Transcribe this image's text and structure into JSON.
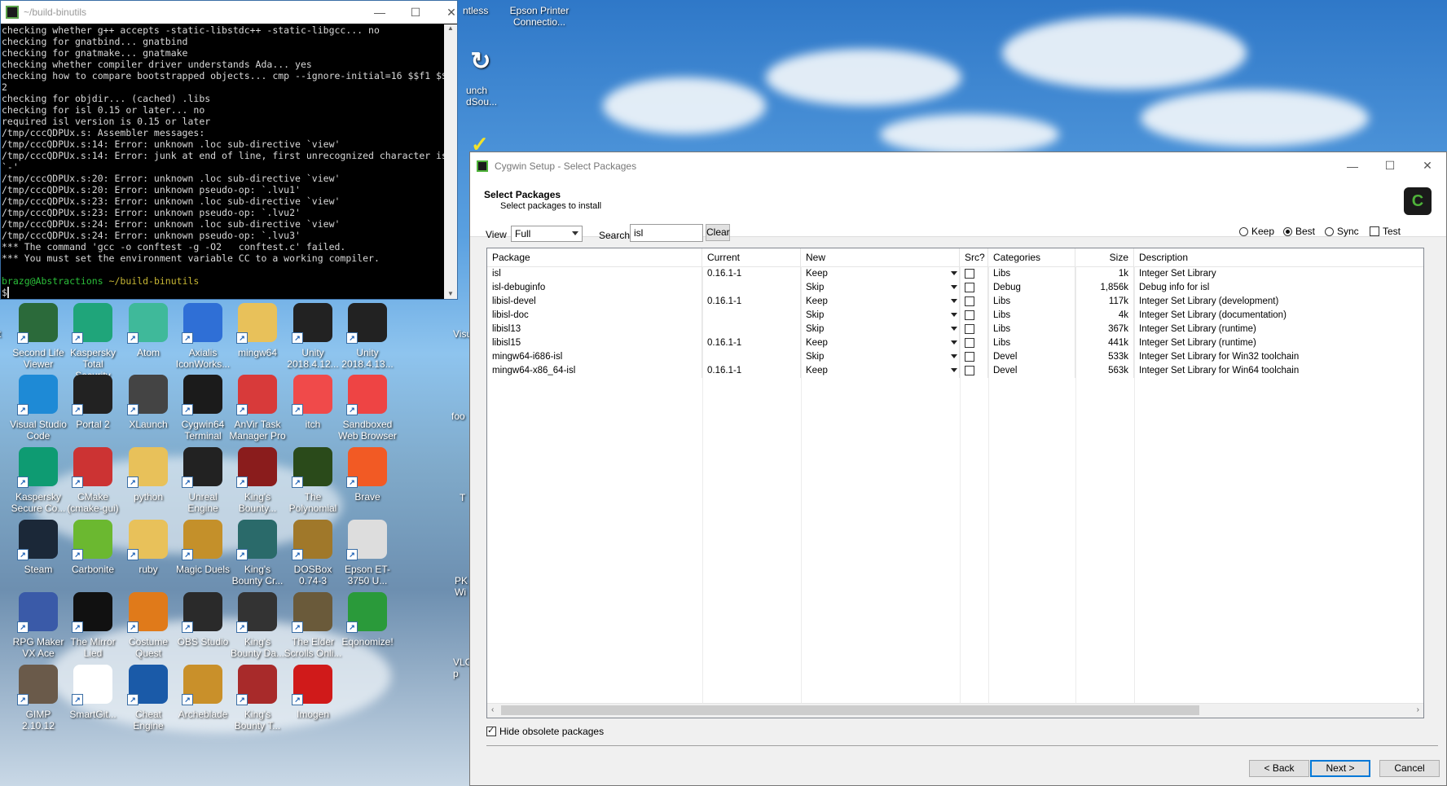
{
  "terminal": {
    "title": "~/build-binutils",
    "lines": [
      "checking whether g++ accepts -static-libstdc++ -static-libgcc... no",
      "checking for gnatbind... gnatbind",
      "checking for gnatmake... gnatmake",
      "checking whether compiler driver understands Ada... yes",
      "checking how to compare bootstrapped objects... cmp --ignore-initial=16 $$f1 $$f",
      "2",
      "checking for objdir... (cached) .libs",
      "checking for isl 0.15 or later... no",
      "required isl version is 0.15 or later",
      "/tmp/cccQDPUx.s: Assembler messages:",
      "/tmp/cccQDPUx.s:14: Error: unknown .loc sub-directive `view'",
      "/tmp/cccQDPUx.s:14: Error: junk at end of line, first unrecognized character is",
      "`-'",
      "/tmp/cccQDPUx.s:20: Error: unknown .loc sub-directive `view'",
      "/tmp/cccQDPUx.s:20: Error: unknown pseudo-op: `.lvu1'",
      "/tmp/cccQDPUx.s:23: Error: unknown .loc sub-directive `view'",
      "/tmp/cccQDPUx.s:23: Error: unknown pseudo-op: `.lvu2'",
      "/tmp/cccQDPUx.s:24: Error: unknown .loc sub-directive `view'",
      "/tmp/cccQDPUx.s:24: Error: unknown pseudo-op: `.lvu3'",
      "*** The command 'gcc -o conftest -g -O2   conftest.c' failed.",
      "*** You must set the environment variable CC to a working compiler.",
      ""
    ],
    "prompt_user": "brazg@Abstractions",
    "prompt_path": "~/build-binutils",
    "prompt_symbol": "$"
  },
  "desktop": {
    "top_labels": [
      "ntless",
      "Epson Printer Connectio...",
      "unch dSou..."
    ],
    "icons": [
      {
        "label": "Second Life Viewer",
        "icon": "second-life-icon",
        "color": "#2b6a3a"
      },
      {
        "label": "Kaspersky Total Security",
        "icon": "kaspersky-icon",
        "color": "#1fa57a"
      },
      {
        "label": "Atom",
        "icon": "atom-icon",
        "color": "#3fb99a"
      },
      {
        "label": "Axialis IconWorks...",
        "icon": "axialis-icon",
        "color": "#2f6fd6"
      },
      {
        "label": "mingw64",
        "icon": "folder-icon",
        "color": "#e8c15a"
      },
      {
        "label": "Unity 2018.4.12...",
        "icon": "unity-icon",
        "color": "#222"
      },
      {
        "label": "Unity 2018.4.13...",
        "icon": "unity-icon",
        "color": "#222"
      },
      {
        "label": "Visual Studio Code",
        "icon": "vscode-icon",
        "color": "#1e8ad6"
      },
      {
        "label": "Portal 2",
        "icon": "portal-icon",
        "color": "#222"
      },
      {
        "label": "XLaunch",
        "icon": "xlaunch-icon",
        "color": "#444"
      },
      {
        "label": "Cygwin64 Terminal",
        "icon": "cygwin-icon",
        "color": "#1b1b1b"
      },
      {
        "label": "AnVir Task Manager Pro",
        "icon": "anvir-icon",
        "color": "#d83a3a"
      },
      {
        "label": "itch",
        "icon": "itch-icon",
        "color": "#f04a4a"
      },
      {
        "label": "Sandboxed Web Browser",
        "icon": "sandbox-icon",
        "color": "#e44"
      },
      {
        "label": "Kaspersky Secure Co...",
        "icon": "kaspersky-vpn-icon",
        "color": "#0e9b72"
      },
      {
        "label": "CMake (cmake-gui)",
        "icon": "cmake-icon",
        "color": "#c33"
      },
      {
        "label": "python",
        "icon": "folder-icon",
        "color": "#e8c15a"
      },
      {
        "label": "Unreal Engine",
        "icon": "unreal-icon",
        "color": "#222"
      },
      {
        "label": "King's Bounty...",
        "icon": "kings-bounty-icon",
        "color": "#8a1c1c"
      },
      {
        "label": "The Polynomial",
        "icon": "polynomial-icon",
        "color": "#2a4a1a"
      },
      {
        "label": "Brave",
        "icon": "brave-icon",
        "color": "#f25a24"
      },
      {
        "label": "Steam",
        "icon": "steam-icon",
        "color": "#1b2838"
      },
      {
        "label": "Carbonite",
        "icon": "carbonite-icon",
        "color": "#6bb830"
      },
      {
        "label": "ruby",
        "icon": "folder-icon",
        "color": "#e8c15a"
      },
      {
        "label": "Magic Duels",
        "icon": "magic-icon",
        "color": "#c4902a"
      },
      {
        "label": "King's Bounty Cr...",
        "icon": "kings-bounty-icon",
        "color": "#2a6a6a"
      },
      {
        "label": "DOSBox 0.74-3",
        "icon": "dosbox-icon",
        "color": "#a0782a"
      },
      {
        "label": "Epson ET-3750 U...",
        "icon": "epson-icon",
        "color": "#ddd"
      },
      {
        "label": "RPG Maker VX Ace",
        "icon": "rpgmaker-icon",
        "color": "#3a5aa8"
      },
      {
        "label": "The Mirror Lied",
        "icon": "mirror-icon",
        "color": "#111"
      },
      {
        "label": "Costume Quest",
        "icon": "costume-quest-icon",
        "color": "#e07a1a"
      },
      {
        "label": "OBS Studio",
        "icon": "obs-icon",
        "color": "#2a2a2a"
      },
      {
        "label": "King's Bounty Da...",
        "icon": "kings-bounty-icon",
        "color": "#333"
      },
      {
        "label": "The Elder Scrolls Onli...",
        "icon": "eso-icon",
        "color": "#6a5a3a"
      },
      {
        "label": "Eqonomize!",
        "icon": "eqonomize-icon",
        "color": "#2a9a3a"
      },
      {
        "label": "GIMP 2.10.12",
        "icon": "gimp-icon",
        "color": "#6a5a4a"
      },
      {
        "label": "SmartGit...",
        "icon": "smartgit-icon",
        "color": "#fff"
      },
      {
        "label": "Cheat Engine",
        "icon": "cheat-engine-icon",
        "color": "#1a5aa8"
      },
      {
        "label": "Archeblade",
        "icon": "archeblade-icon",
        "color": "#c9902a"
      },
      {
        "label": "King's Bounty T...",
        "icon": "kings-bounty-icon",
        "color": "#a82a2a"
      },
      {
        "label": "Imogen",
        "icon": "imogen-icon",
        "color": "#d01a1a"
      }
    ],
    "edge_labels": [
      "t",
      "Visu",
      "foo",
      "T",
      "PK Wi",
      "VLC p"
    ]
  },
  "cygwin": {
    "title": "Cygwin Setup - Select Packages",
    "heading": "Select Packages",
    "subheading": "Select packages to install",
    "view_label": "View",
    "view_value": "Full",
    "search_label": "Search",
    "search_value": "isl",
    "clear_label": "Clear",
    "radios": [
      {
        "label": "Keep",
        "checked": false
      },
      {
        "label": "Best",
        "checked": true
      },
      {
        "label": "Sync",
        "checked": false
      }
    ],
    "test_label": "Test",
    "columns": [
      "Package",
      "Current",
      "New",
      "Src?",
      "Categories",
      "Size",
      "Description"
    ],
    "rows": [
      {
        "package": "isl",
        "current": "0.16.1-1",
        "new": "Keep",
        "category": "Libs",
        "size": "1k",
        "description": "Integer Set Library"
      },
      {
        "package": "isl-debuginfo",
        "current": "",
        "new": "Skip",
        "category": "Debug",
        "size": "1,856k",
        "description": "Debug info for isl"
      },
      {
        "package": "libisl-devel",
        "current": "0.16.1-1",
        "new": "Keep",
        "category": "Libs",
        "size": "117k",
        "description": "Integer Set Library (development)"
      },
      {
        "package": "libisl-doc",
        "current": "",
        "new": "Skip",
        "category": "Libs",
        "size": "4k",
        "description": "Integer Set Library (documentation)"
      },
      {
        "package": "libisl13",
        "current": "",
        "new": "Skip",
        "category": "Libs",
        "size": "367k",
        "description": "Integer Set Library (runtime)"
      },
      {
        "package": "libisl15",
        "current": "0.16.1-1",
        "new": "Keep",
        "category": "Libs",
        "size": "441k",
        "description": "Integer Set Library (runtime)"
      },
      {
        "package": "mingw64-i686-isl",
        "current": "",
        "new": "Skip",
        "category": "Devel",
        "size": "533k",
        "description": "Integer Set Library for Win32 toolchain"
      },
      {
        "package": "mingw64-x86_64-isl",
        "current": "0.16.1-1",
        "new": "Keep",
        "category": "Devel",
        "size": "563k",
        "description": "Integer Set Library for Win64 toolchain"
      }
    ],
    "hide_obsolete_label": "Hide obsolete packages",
    "back_label": "< Back",
    "next_label": "Next >",
    "cancel_label": "Cancel"
  }
}
